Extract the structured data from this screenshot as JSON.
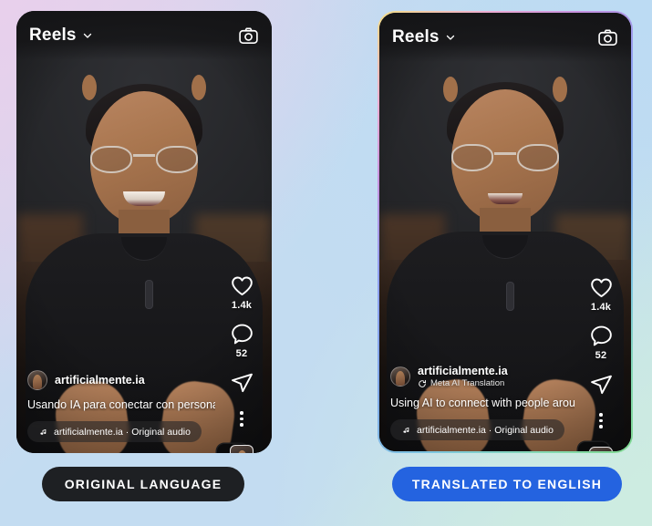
{
  "background": {
    "gradient_colors": [
      "#e8d0ec",
      "#bcdbf3",
      "#c3dcf1",
      "#cfeade"
    ]
  },
  "panels": [
    {
      "id": "original",
      "header": {
        "title": "Reels",
        "chevron_icon": "chevron-down-icon",
        "camera_icon": "camera-icon"
      },
      "actions": {
        "like": {
          "icon": "heart-icon",
          "count": "1.4k"
        },
        "comment": {
          "icon": "comment-icon",
          "count": "52"
        },
        "share": {
          "icon": "send-icon"
        },
        "more": {
          "icon": "more-options-icon"
        },
        "thumbnail": {
          "icon": "audio-thumbnail-icon"
        }
      },
      "caption": {
        "username": "artificialmente.ia",
        "translation_note": null,
        "translation_icon": null,
        "text": "Usando IA para conectar con personas de ...",
        "audio_icon": "music-note-icon",
        "audio_text": "artificialmente.ia · Original audio"
      },
      "label": {
        "text": "ORIGINAL LANGUAGE",
        "background": "#1e2023",
        "color": "#ffffff"
      },
      "has_gradient_border": false
    },
    {
      "id": "translated",
      "header": {
        "title": "Reels",
        "chevron_icon": "chevron-down-icon",
        "camera_icon": "camera-icon"
      },
      "actions": {
        "like": {
          "icon": "heart-icon",
          "count": "1.4k"
        },
        "comment": {
          "icon": "comment-icon",
          "count": "52"
        },
        "share": {
          "icon": "send-icon"
        },
        "more": {
          "icon": "more-options-icon"
        },
        "thumbnail": {
          "icon": "audio-thumbnail-icon"
        }
      },
      "caption": {
        "username": "artificialmente.ia",
        "translation_note": "Meta AI Translation",
        "translation_icon": "refresh-circle-icon",
        "text": "Using AI to connect with people around ...",
        "audio_icon": "music-note-icon",
        "audio_text": "artificialmente.ia · Original audio"
      },
      "label": {
        "text": "TRANSLATED TO ENGLISH",
        "background": "#2463e0",
        "color": "#ffffff"
      },
      "has_gradient_border": true
    }
  ]
}
